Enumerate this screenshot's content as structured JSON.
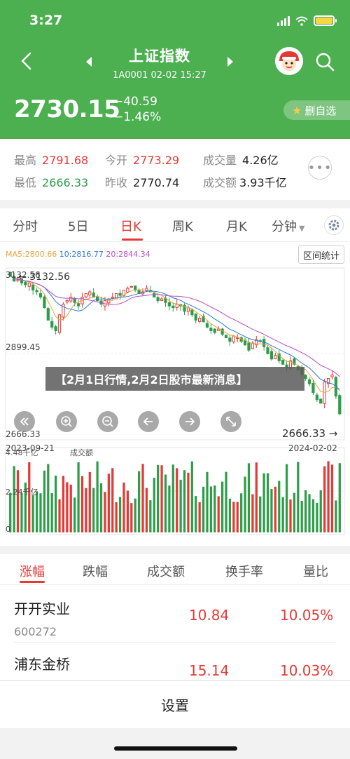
{
  "status": {
    "time": "3:27"
  },
  "header": {
    "title": "上证指数",
    "code_time": "1A0001   02-02 15:27",
    "price": "2730.15",
    "change": "−40.59",
    "change_pct": "−1.46%",
    "unfav_label": "删自选"
  },
  "stats": {
    "high_label": "最高",
    "high": "2791.68",
    "open_label": "今开",
    "open": "2773.29",
    "vol_label": "成交量",
    "vol": "4.26亿",
    "low_label": "最低",
    "low": "2666.33",
    "prev_label": "昨收",
    "prev": "2770.74",
    "amt_label": "成交额",
    "amt": "3.93千亿"
  },
  "chart_tabs": [
    "分时",
    "5日",
    "日K",
    "周K",
    "月K",
    "分钟"
  ],
  "chart_tab_active": "日K",
  "indicators": {
    "ma5": "MA5:2800.66",
    "ma10": "10:2816.77",
    "ma20": "20:2844.34"
  },
  "range_button": "区间统计",
  "axis": {
    "top": "3132.56",
    "mid": "2899.45",
    "bottom": "2666.33",
    "max_label": "3132.56",
    "min_label": "2666.33 →",
    "date_start": "2023-09-21",
    "date_end": "2024-02-02"
  },
  "volume": {
    "top_label": "4.48千亿",
    "name": "成交额",
    "mid_label": "2.24千亿",
    "zero": "0"
  },
  "colors": {
    "up": "#e53935",
    "down": "#2e9d4a",
    "header": "#4caf50"
  },
  "banner": "【2月1日行情,2月2日股市最新消息】",
  "rank_tabs": [
    "涨幅",
    "跌幅",
    "成交额",
    "换手率",
    "量比"
  ],
  "rank_rows": [
    {
      "name": "开开实业",
      "code": "600272",
      "price": "10.84",
      "pct": "10.05%"
    },
    {
      "name": "浦东金桥",
      "code": "",
      "price": "15.14",
      "pct": "10.03%"
    }
  ],
  "settings_label": "设置",
  "chart_data": {
    "type": "candlestick",
    "x_start": "2023-09-21",
    "x_end": "2024-02-02",
    "ylim": [
      2666.33,
      3132.56
    ],
    "y_ticks": [
      3132.56,
      2899.45,
      2666.33
    ],
    "close_series": [
      3120,
      3105,
      3110,
      3100,
      3095,
      3100,
      3080,
      3075,
      3060,
      3030,
      2995,
      2975,
      2965,
      3010,
      3040,
      3050,
      3060,
      3045,
      3035,
      3060,
      3070,
      3075,
      3060,
      3050,
      3040,
      3050,
      3055,
      3060,
      3070,
      3065,
      3080,
      3085,
      3090,
      3080,
      3070,
      3075,
      3085,
      3075,
      3060,
      3050,
      3055,
      3045,
      3035,
      3030,
      3040,
      3035,
      3020,
      3030,
      3010,
      2995,
      3000,
      2990,
      2975,
      2965,
      2960,
      2970,
      2955,
      2945,
      2935,
      2950,
      2945,
      2935,
      2925,
      2910,
      2930,
      2940,
      2935,
      2920,
      2900,
      2885,
      2895,
      2880,
      2870,
      2860,
      2880,
      2870,
      2855,
      2840,
      2830,
      2815,
      2790,
      2770,
      2760,
      2820,
      2830,
      2840,
      2780,
      2730
    ],
    "volume_ylim": [
      0,
      4.48
    ],
    "volume_unit": "千亿"
  }
}
